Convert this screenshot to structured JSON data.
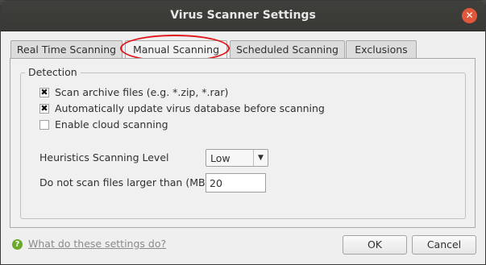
{
  "window": {
    "title": "Virus Scanner Settings",
    "close_glyph": "✕"
  },
  "tabs": [
    {
      "label": "Real Time Scanning"
    },
    {
      "label": "Manual Scanning",
      "active": true
    },
    {
      "label": "Scheduled Scanning"
    },
    {
      "label": "Exclusions"
    }
  ],
  "detection": {
    "group_label": "Detection",
    "options": [
      {
        "label": "Scan archive files (e.g. *.zip, *.rar)",
        "checked": true,
        "mark": "✖"
      },
      {
        "label": "Automatically update virus database before scanning",
        "checked": true,
        "mark": "✖"
      },
      {
        "label": "Enable cloud scanning",
        "checked": false,
        "mark": ""
      }
    ],
    "heuristics": {
      "label": "Heuristics Scanning Level",
      "value": "Low",
      "arrow": "▼"
    },
    "max_size": {
      "label": "Do not scan files larger than (MB)",
      "value": "20"
    }
  },
  "footer": {
    "help_glyph": "?",
    "help_text": "What do these settings do?",
    "ok_label": "OK",
    "cancel_label": "Cancel"
  },
  "colors": {
    "titlebar": "#3c3c39",
    "close": "#e0573b",
    "highlight_ring": "#e0141a",
    "help": "#6aa92a"
  }
}
